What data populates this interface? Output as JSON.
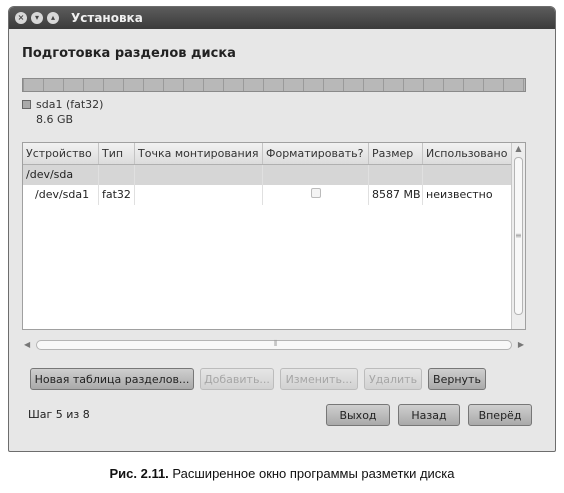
{
  "window": {
    "title": "Установка"
  },
  "page": {
    "heading": "Подготовка разделов диска"
  },
  "disk": {
    "legend_name": "sda1 (fat32)",
    "legend_size": "8.6 GB"
  },
  "table": {
    "columns": [
      "Устройство",
      "Тип",
      "Точка монтирования",
      "Форматировать?",
      "Размер",
      "Использовано"
    ],
    "group_row": {
      "device": "/dev/sda"
    },
    "rows": [
      {
        "device": "/dev/sda1",
        "type": "fat32",
        "mount": "",
        "format": false,
        "size": "8587 MB",
        "used": "неизвестно"
      }
    ]
  },
  "actions": {
    "new_table": "Новая таблица разделов...",
    "add": "Добавить...",
    "change": "Изменить...",
    "delete": "Удалить",
    "revert": "Вернуть"
  },
  "footer": {
    "step": "Шаг 5 из 8",
    "quit": "Выход",
    "back": "Назад",
    "forward": "Вперёд"
  },
  "caption": {
    "label": "Рис. 2.11.",
    "text": " Расширенное окно программы разметки диска"
  }
}
